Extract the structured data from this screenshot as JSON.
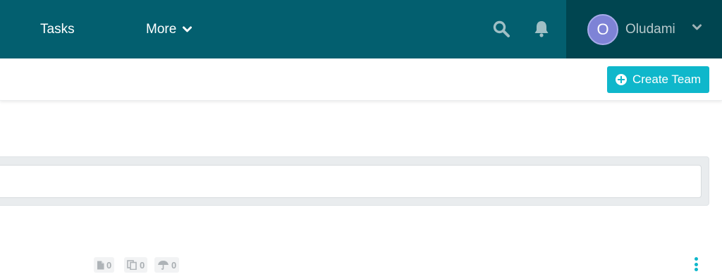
{
  "nav": {
    "tasks_label": "Tasks",
    "more_label": "More",
    "search_icon": "search-icon",
    "bell_icon": "bell-icon",
    "user": {
      "avatar_initial": "O",
      "name": "Oludami"
    }
  },
  "toolbar": {
    "create_team_label": "Create Team"
  },
  "search": {
    "value": "",
    "placeholder": ""
  },
  "item": {
    "documents_count": "0",
    "copies_count": "0",
    "umbrella_count": "0"
  },
  "colors": {
    "navbar": "#035f6f",
    "user_area": "#004550",
    "accent": "#0fb7cb",
    "avatar": "#7e83d6"
  }
}
